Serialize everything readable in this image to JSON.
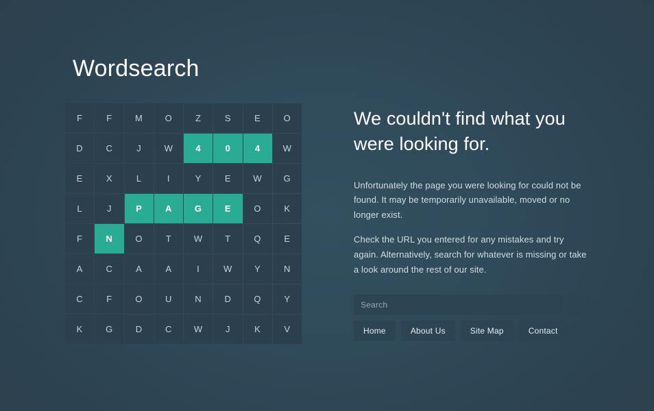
{
  "page": {
    "title": "Wordsearch",
    "background_color": "#2c3e4c",
    "accent_color": "#2aab93"
  },
  "wordsearch": {
    "columns": 8,
    "rows": 8,
    "highlight_color": "#2aab93",
    "cell_color": "#2b3f4d",
    "grid": [
      [
        {
          "letter": "F",
          "highlighted": false
        },
        {
          "letter": "F",
          "highlighted": false
        },
        {
          "letter": "M",
          "highlighted": false
        },
        {
          "letter": "O",
          "highlighted": false
        },
        {
          "letter": "Z",
          "highlighted": false
        },
        {
          "letter": "S",
          "highlighted": false
        },
        {
          "letter": "E",
          "highlighted": false
        },
        {
          "letter": "O",
          "highlighted": false
        }
      ],
      [
        {
          "letter": "D",
          "highlighted": false
        },
        {
          "letter": "C",
          "highlighted": false
        },
        {
          "letter": "J",
          "highlighted": false
        },
        {
          "letter": "W",
          "highlighted": false
        },
        {
          "letter": "4",
          "highlighted": true
        },
        {
          "letter": "0",
          "highlighted": true
        },
        {
          "letter": "4",
          "highlighted": true
        },
        {
          "letter": "W",
          "highlighted": false
        }
      ],
      [
        {
          "letter": "E",
          "highlighted": false
        },
        {
          "letter": "X",
          "highlighted": false
        },
        {
          "letter": "L",
          "highlighted": false
        },
        {
          "letter": "I",
          "highlighted": false
        },
        {
          "letter": "Y",
          "highlighted": false
        },
        {
          "letter": "E",
          "highlighted": false
        },
        {
          "letter": "W",
          "highlighted": false
        },
        {
          "letter": "G",
          "highlighted": false
        }
      ],
      [
        {
          "letter": "L",
          "highlighted": false
        },
        {
          "letter": "J",
          "highlighted": false
        },
        {
          "letter": "P",
          "highlighted": true
        },
        {
          "letter": "A",
          "highlighted": true
        },
        {
          "letter": "G",
          "highlighted": true
        },
        {
          "letter": "E",
          "highlighted": true
        },
        {
          "letter": "O",
          "highlighted": false
        },
        {
          "letter": "K",
          "highlighted": false
        }
      ],
      [
        {
          "letter": "F",
          "highlighted": false
        },
        {
          "letter": "N",
          "highlighted": true
        },
        {
          "letter": "O",
          "highlighted": false
        },
        {
          "letter": "T",
          "highlighted": false
        },
        {
          "letter": "W",
          "highlighted": false
        },
        {
          "letter": "T",
          "highlighted": false
        },
        {
          "letter": "Q",
          "highlighted": false
        },
        {
          "letter": "E",
          "highlighted": false
        }
      ],
      [
        {
          "letter": "A",
          "highlighted": false
        },
        {
          "letter": "C",
          "highlighted": false
        },
        {
          "letter": "A",
          "highlighted": false
        },
        {
          "letter": "A",
          "highlighted": false
        },
        {
          "letter": "I",
          "highlighted": false
        },
        {
          "letter": "W",
          "highlighted": false
        },
        {
          "letter": "Y",
          "highlighted": false
        },
        {
          "letter": "N",
          "highlighted": false
        }
      ],
      [
        {
          "letter": "C",
          "highlighted": false
        },
        {
          "letter": "F",
          "highlighted": false
        },
        {
          "letter": "O",
          "highlighted": false
        },
        {
          "letter": "U",
          "highlighted": false
        },
        {
          "letter": "N",
          "highlighted": false
        },
        {
          "letter": "D",
          "highlighted": false
        },
        {
          "letter": "Q",
          "highlighted": false
        },
        {
          "letter": "Y",
          "highlighted": false
        }
      ],
      [
        {
          "letter": "K",
          "highlighted": false
        },
        {
          "letter": "G",
          "highlighted": false
        },
        {
          "letter": "D",
          "highlighted": false
        },
        {
          "letter": "C",
          "highlighted": false
        },
        {
          "letter": "W",
          "highlighted": false
        },
        {
          "letter": "J",
          "highlighted": false
        },
        {
          "letter": "K",
          "highlighted": false
        },
        {
          "letter": "V",
          "highlighted": false
        }
      ]
    ]
  },
  "content": {
    "headline": "We couldn't find what you were looking for.",
    "paragraphs": [
      "Unfortunately the page you were looking for could not be found. It may be temporarily unavailable, moved or no longer exist.",
      "Check the URL you entered for any mistakes and try again. Alternatively, search for whatever is missing or take a look around the rest of our site."
    ]
  },
  "search": {
    "placeholder": "Search",
    "value": "",
    "submit_icon": "search-icon"
  },
  "nav": {
    "buttons": [
      {
        "label": "Home"
      },
      {
        "label": "About Us"
      },
      {
        "label": "Site Map"
      },
      {
        "label": "Contact"
      }
    ],
    "icon_buttons": [
      {
        "icon": "social-icon-1"
      },
      {
        "icon": "social-icon-2"
      }
    ]
  }
}
